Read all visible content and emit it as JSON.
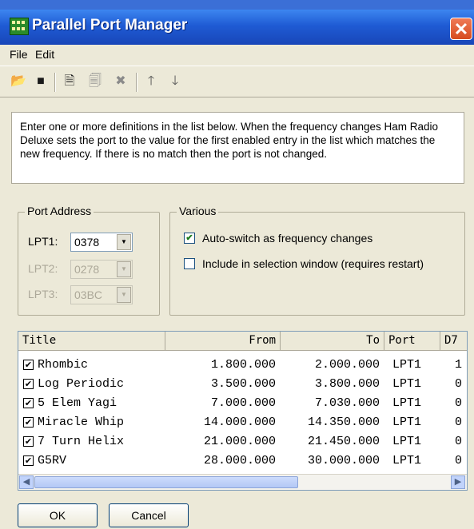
{
  "window": {
    "title": "Parallel Port Manager",
    "close_symbol": "✕"
  },
  "menu": [
    "File",
    "Edit"
  ],
  "toolbar": {
    "icons": [
      "open-folder-icon",
      "save-icon",
      "new-entry-icon",
      "properties-icon",
      "delete-icon",
      "move-up-icon",
      "move-down-icon"
    ],
    "glyphs": {
      "open": "📂",
      "save": "■",
      "new": "🗎",
      "properties": "🗐",
      "delete": "✖",
      "up": "🡑",
      "down": "🡓"
    }
  },
  "info_text": "Enter one or more definitions in the list below. When the frequency changes Ham Radio Deluxe sets the port to the value for the first enabled entry in the list which matches the new frequency. If there is no match then the port is not changed.",
  "port_address": {
    "legend": "Port Address",
    "lpt1": {
      "label": "LPT1:",
      "value": "0378",
      "enabled": true
    },
    "lpt2": {
      "label": "LPT2:",
      "value": "0278",
      "enabled": false
    },
    "lpt3": {
      "label": "LPT3:",
      "value": "03BC",
      "enabled": false
    }
  },
  "various": {
    "legend": "Various",
    "auto_switch": {
      "label": "Auto-switch as frequency changes",
      "checked": true
    },
    "include_selection": {
      "label": "Include in selection window (requires restart)",
      "checked": false
    }
  },
  "list": {
    "columns": [
      "Title",
      "From",
      "To",
      "Port",
      "D7"
    ],
    "rows": [
      {
        "title": "Rhombic",
        "from": "1.800.000",
        "to": "2.000.000",
        "port": "LPT1",
        "d7": "1",
        "enabled": true
      },
      {
        "title": "Log Periodic",
        "from": "3.500.000",
        "to": "3.800.000",
        "port": "LPT1",
        "d7": "0",
        "enabled": true
      },
      {
        "title": "5 Elem Yagi",
        "from": "7.000.000",
        "to": "7.030.000",
        "port": "LPT1",
        "d7": "0",
        "enabled": true
      },
      {
        "title": "Miracle Whip",
        "from": "14.000.000",
        "to": "14.350.000",
        "port": "LPT1",
        "d7": "0",
        "enabled": true
      },
      {
        "title": "7 Turn Helix",
        "from": "21.000.000",
        "to": "21.450.000",
        "port": "LPT1",
        "d7": "0",
        "enabled": true
      },
      {
        "title": "G5RV",
        "from": "28.000.000",
        "to": "30.000.000",
        "port": "LPT1",
        "d7": "0",
        "enabled": true
      }
    ]
  },
  "buttons": {
    "ok": "OK",
    "cancel": "Cancel"
  },
  "glyphs": {
    "check": "✔",
    "dropdown": "▼",
    "scroll_left": "◀",
    "scroll_right": "▶"
  },
  "colors": {
    "title_bar": "#1f5bd4",
    "close": "#d64b1e",
    "check": "#1a7a1a"
  }
}
